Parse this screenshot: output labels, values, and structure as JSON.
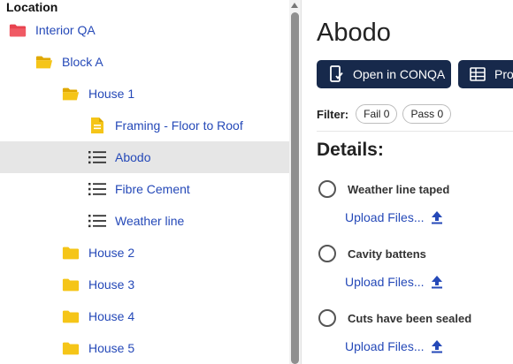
{
  "left_panel": {
    "header": "Location",
    "items": [
      {
        "label": "Interior QA",
        "icon": "folder-red-icon"
      },
      {
        "label": "Block A",
        "icon": "folder-open-icon"
      },
      {
        "label": "House 1",
        "icon": "folder-open-icon"
      },
      {
        "label": "Framing - Floor to Roof",
        "icon": "document-icon"
      },
      {
        "label": "Abodo",
        "icon": "checklist-icon",
        "selected": true
      },
      {
        "label": "Fibre Cement",
        "icon": "checklist-icon"
      },
      {
        "label": "Weather line",
        "icon": "checklist-icon"
      },
      {
        "label": "House 2",
        "icon": "folder-icon"
      },
      {
        "label": "House 3",
        "icon": "folder-icon"
      },
      {
        "label": "House 4",
        "icon": "folder-icon"
      },
      {
        "label": "House 5",
        "icon": "folder-icon"
      }
    ]
  },
  "main": {
    "title": "Abodo",
    "actions": {
      "open_label": "Open in CONQA",
      "project_label": "Proje"
    },
    "filter": {
      "label": "Filter:",
      "fail_label": "Fail 0",
      "pass_label": "Pass 0"
    },
    "details_heading": "Details:",
    "checks": [
      {
        "label": "Weather line taped",
        "upload": "Upload Files..."
      },
      {
        "label": "Cavity battens",
        "upload": "Upload Files..."
      },
      {
        "label": "Cuts have been sealed",
        "upload": "Upload Files..."
      }
    ]
  },
  "colors": {
    "link": "#2549b8",
    "button_bg": "#17294b",
    "folder_yellow": "#f5c518",
    "folder_red": "#e8434f",
    "selected_row": "#e6e6e6"
  }
}
